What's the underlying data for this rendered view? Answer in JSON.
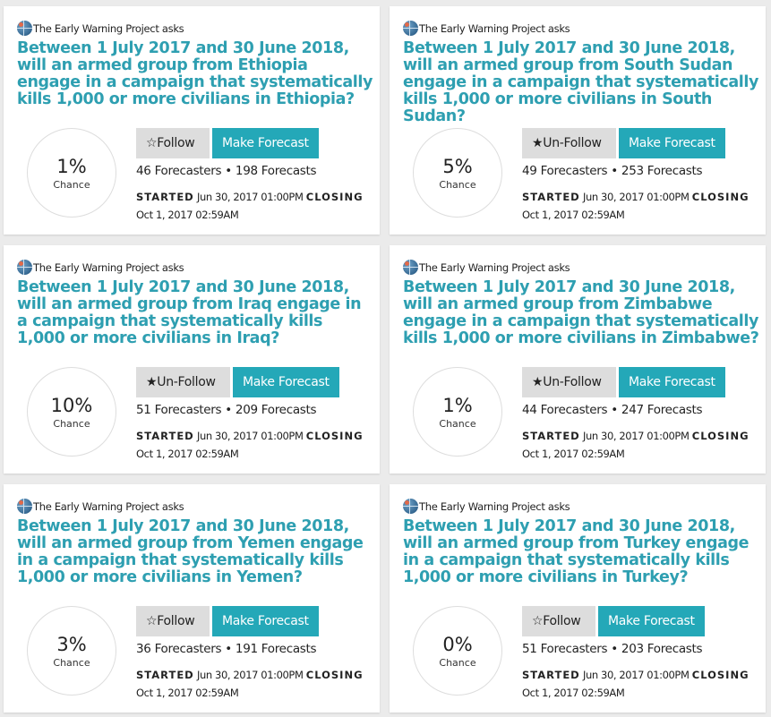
{
  "accent": "#2e9fb1",
  "button_color": "#24a8b8",
  "cards": [
    {
      "asker": "The Early Warning Project asks",
      "title": "Between 1 July 2017 and 30 June 2018, will an armed group from Ethiopia engage in a campaign that systematically kills 1,000 or more civilians in Ethiopia?",
      "chance": "1%",
      "chance_label": "Chance",
      "follow_icon": "star-outline",
      "follow": "Follow",
      "make": "Make Forecast",
      "stats": "46 Forecasters • 198 Forecasts",
      "started_label": "STARTED",
      "started": "Jun 30, 2017 01:00PM",
      "closing_label": "CLOSING",
      "closing": "Oct 1, 2017 02:59AM"
    },
    {
      "asker": "The Early Warning Project asks",
      "title": "Between 1 July 2017 and 30 June 2018, will an armed group from South Sudan engage in a campaign that systematically kills 1,000 or more civilians in South Sudan?",
      "chance": "5%",
      "chance_label": "Chance",
      "follow_icon": "star-filled",
      "follow": "Un-Follow",
      "make": "Make Forecast",
      "stats": "49 Forecasters • 253 Forecasts",
      "started_label": "STARTED",
      "started": "Jun 30, 2017 01:00PM",
      "closing_label": "CLOSING",
      "closing": "Oct 1, 2017 02:59AM"
    },
    {
      "asker": "The Early Warning Project asks",
      "title": "Between 1 July 2017 and 30 June 2018, will an armed group from Iraq engage in a campaign that systematically kills 1,000 or more civilians in Iraq?",
      "chance": "10%",
      "chance_label": "Chance",
      "follow_icon": "star-filled",
      "follow": "Un-Follow",
      "make": "Make Forecast",
      "stats": "51 Forecasters • 209 Forecasts",
      "started_label": "STARTED",
      "started": "Jun 30, 2017 01:00PM",
      "closing_label": "CLOSING",
      "closing": "Oct 1, 2017 02:59AM"
    },
    {
      "asker": "The Early Warning Project asks",
      "title": "Between 1 July 2017 and 30 June 2018, will an armed group from Zimbabwe engage in a campaign that systematically kills 1,000 or more civilians in Zimbabwe?",
      "chance": "1%",
      "chance_label": "Chance",
      "follow_icon": "star-filled",
      "follow": "Un-Follow",
      "make": "Make Forecast",
      "stats": "44 Forecasters • 247 Forecasts",
      "started_label": "STARTED",
      "started": "Jun 30, 2017 01:00PM",
      "closing_label": "CLOSING",
      "closing": "Oct 1, 2017 02:59AM"
    },
    {
      "asker": "The Early Warning Project asks",
      "title": "Between 1 July 2017 and 30 June 2018, will an armed group from Yemen engage in a campaign that systematically kills 1,000 or more civilians in Yemen?",
      "chance": "3%",
      "chance_label": "Chance",
      "follow_icon": "star-outline",
      "follow": "Follow",
      "make": "Make Forecast",
      "stats": "36 Forecasters • 191 Forecasts",
      "started_label": "STARTED",
      "started": "Jun 30, 2017 01:00PM",
      "closing_label": "CLOSING",
      "closing": "Oct 1, 2017 02:59AM"
    },
    {
      "asker": "The Early Warning Project asks",
      "title": "Between 1 July 2017 and 30 June 2018, will an armed group from Turkey engage in a campaign that systematically kills 1,000 or more civilians in Turkey?",
      "chance": "0%",
      "chance_label": "Chance",
      "follow_icon": "star-outline",
      "follow": "Follow",
      "make": "Make Forecast",
      "stats": "51 Forecasters • 203 Forecasts",
      "started_label": "STARTED",
      "started": "Jun 30, 2017 01:00PM",
      "closing_label": "CLOSING",
      "closing": "Oct 1, 2017 02:59AM"
    }
  ]
}
